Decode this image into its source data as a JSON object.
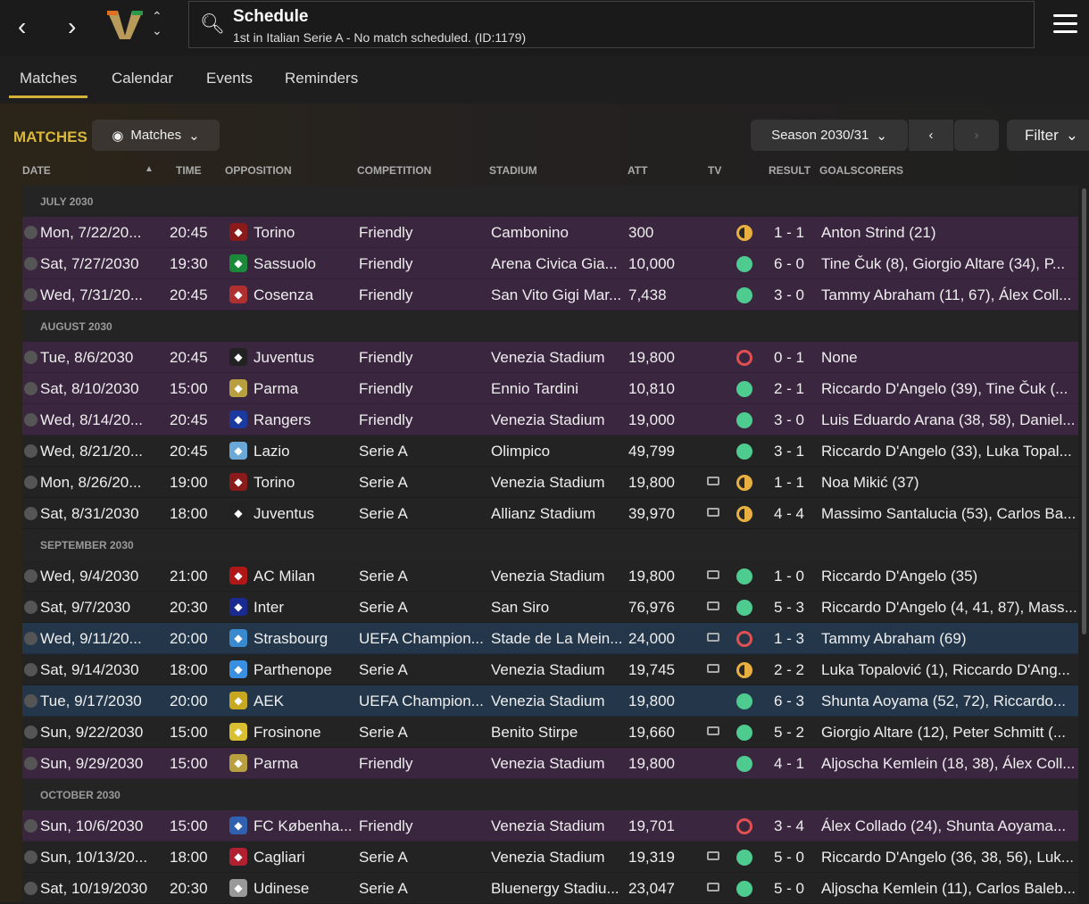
{
  "header": {
    "title": "Schedule",
    "subtitle": "1st in Italian Serie A - No match scheduled. (ID:1179)"
  },
  "tabs": [
    "Matches",
    "Calendar",
    "Events",
    "Reminders"
  ],
  "section": {
    "title": "MATCHES",
    "view_label": "Matches",
    "season": "Season 2030/31",
    "filter": "Filter"
  },
  "columns": [
    "DATE",
    "TIME",
    "OPPOSITION",
    "COMPETITION",
    "STADIUM",
    "ATT",
    "TV",
    "RESULT",
    "GOALSCORERS"
  ],
  "colors": {
    "win": "#4ecb8f",
    "draw": "#e8b040",
    "loss": "#e05050",
    "accent": "#d8b73c"
  },
  "groups": [
    {
      "label": "JULY 2030",
      "rows": [
        {
          "date": "Mon, 7/22/20...",
          "time": "20:45",
          "opp": "Torino",
          "comp": "Friendly",
          "stadium": "Cambonino",
          "att": "300",
          "tv": false,
          "outcome": "draw",
          "result": "1 - 1",
          "scorers": "Anton Strind (21)",
          "style": "p",
          "crest": "#8b1a1a"
        },
        {
          "date": "Sat, 7/27/2030",
          "time": "19:30",
          "opp": "Sassuolo",
          "comp": "Friendly",
          "stadium": "Arena Civica Gia...",
          "att": "10,000",
          "tv": false,
          "outcome": "win",
          "result": "6 - 0",
          "scorers": "Tine Čuk (8), Giorgio Altare (34), P...",
          "style": "p",
          "crest": "#1a8a3a"
        },
        {
          "date": "Wed, 7/31/20...",
          "time": "20:45",
          "opp": "Cosenza",
          "comp": "Friendly",
          "stadium": "San Vito Gigi Mar...",
          "att": "7,438",
          "tv": false,
          "outcome": "win",
          "result": "3 - 0",
          "scorers": "Tammy Abraham (11, 67), Álex Coll...",
          "style": "p",
          "crest": "#b03030"
        }
      ]
    },
    {
      "label": "AUGUST 2030",
      "rows": [
        {
          "date": "Tue, 8/6/2030",
          "time": "20:45",
          "opp": "Juventus",
          "comp": "Friendly",
          "stadium": "Venezia Stadium",
          "att": "19,800",
          "tv": false,
          "outcome": "loss",
          "result": "0 - 1",
          "scorers": "None",
          "style": "p",
          "crest": "#222"
        },
        {
          "date": "Sat, 8/10/2030",
          "time": "15:00",
          "opp": "Parma",
          "comp": "Friendly",
          "stadium": "Ennio Tardini",
          "att": "10,810",
          "tv": false,
          "outcome": "win",
          "result": "2 - 1",
          "scorers": "Riccardo D'Angelo (39), Tine Čuk (...",
          "style": "p",
          "crest": "#b8a040"
        },
        {
          "date": "Wed, 8/14/20...",
          "time": "20:45",
          "opp": "Rangers",
          "comp": "Friendly",
          "stadium": "Venezia Stadium",
          "att": "19,000",
          "tv": false,
          "outcome": "win",
          "result": "3 - 0",
          "scorers": "Luis Eduardo Arana (38, 58), Daniel...",
          "style": "p",
          "crest": "#1a3aa0"
        },
        {
          "date": "Wed, 8/21/20...",
          "time": "20:45",
          "opp": "Lazio",
          "comp": "Serie A",
          "stadium": "Olimpico",
          "att": "49,799",
          "tv": false,
          "outcome": "win",
          "result": "3 - 1",
          "scorers": "Riccardo D'Angelo (33), Luka Topal...",
          "style": "d",
          "crest": "#6aa8d8"
        },
        {
          "date": "Mon, 8/26/20...",
          "time": "19:00",
          "opp": "Torino",
          "comp": "Serie A",
          "stadium": "Venezia Stadium",
          "att": "19,800",
          "tv": true,
          "outcome": "draw",
          "result": "1 - 1",
          "scorers": "Noa Mikić (37)",
          "style": "d",
          "crest": "#8b1a1a"
        },
        {
          "date": "Sat, 8/31/2030",
          "time": "18:00",
          "opp": "Juventus",
          "comp": "Serie A",
          "stadium": "Allianz Stadium",
          "att": "39,970",
          "tv": true,
          "outcome": "draw",
          "result": "4 - 4",
          "scorers": "Massimo Santalucia (53), Carlos Ba...",
          "style": "d",
          "crest": "#222"
        }
      ]
    },
    {
      "label": "SEPTEMBER 2030",
      "rows": [
        {
          "date": "Wed, 9/4/2030",
          "time": "21:00",
          "opp": "AC Milan",
          "comp": "Serie A",
          "stadium": "Venezia Stadium",
          "att": "19,800",
          "tv": true,
          "outcome": "win",
          "result": "1 - 0",
          "scorers": "Riccardo D'Angelo (35)",
          "style": "d",
          "crest": "#b01818"
        },
        {
          "date": "Sat, 9/7/2030",
          "time": "20:30",
          "opp": "Inter",
          "comp": "Serie A",
          "stadium": "San Siro",
          "att": "76,976",
          "tv": true,
          "outcome": "win",
          "result": "5 - 3",
          "scorers": "Riccardo D'Angelo (4, 41, 87), Mass...",
          "style": "d",
          "crest": "#1a2a90"
        },
        {
          "date": "Wed, 9/11/20...",
          "time": "20:00",
          "opp": "Strasbourg",
          "comp": "UEFA Champion...",
          "stadium": "Stade de La Mein...",
          "att": "24,000",
          "tv": true,
          "outcome": "loss",
          "result": "1 - 3",
          "scorers": "Tammy Abraham (69)",
          "style": "b",
          "crest": "#3a8ad0"
        },
        {
          "date": "Sat, 9/14/2030",
          "time": "18:00",
          "opp": "Parthenope",
          "comp": "Serie A",
          "stadium": "Venezia Stadium",
          "att": "19,745",
          "tv": true,
          "outcome": "draw",
          "result": "2 - 2",
          "scorers": "Luka Topalović (1), Riccardo D'Ang...",
          "style": "d",
          "crest": "#3a90e0"
        },
        {
          "date": "Tue, 9/17/2030",
          "time": "20:00",
          "opp": "AEK",
          "comp": "UEFA Champion...",
          "stadium": "Venezia Stadium",
          "att": "19,800",
          "tv": false,
          "outcome": "win",
          "result": "6 - 3",
          "scorers": "Shunta Aoyama (52, 72), Riccardo...",
          "style": "b",
          "crest": "#c8a820"
        },
        {
          "date": "Sun, 9/22/2030",
          "time": "15:00",
          "opp": "Frosinone",
          "comp": "Serie A",
          "stadium": "Benito Stirpe",
          "att": "19,660",
          "tv": true,
          "outcome": "win",
          "result": "5 - 2",
          "scorers": "Giorgio Altare (12), Peter Schmitt (...",
          "style": "d",
          "crest": "#d8c030"
        },
        {
          "date": "Sun, 9/29/2030",
          "time": "15:00",
          "opp": "Parma",
          "comp": "Friendly",
          "stadium": "Venezia Stadium",
          "att": "19,800",
          "tv": false,
          "outcome": "win",
          "result": "4 - 1",
          "scorers": "Aljoscha Kemlein (18, 38), Álex Coll...",
          "style": "p",
          "crest": "#b8a040"
        }
      ]
    },
    {
      "label": "OCTOBER 2030",
      "rows": [
        {
          "date": "Sun, 10/6/2030",
          "time": "15:00",
          "opp": "FC Københa...",
          "comp": "Friendly",
          "stadium": "Venezia Stadium",
          "att": "19,701",
          "tv": false,
          "outcome": "loss",
          "result": "3 - 4",
          "scorers": "Álex Collado (24), Shunta Aoyama...",
          "style": "p",
          "crest": "#3060b0"
        },
        {
          "date": "Sun, 10/13/20...",
          "time": "18:00",
          "opp": "Cagliari",
          "comp": "Serie A",
          "stadium": "Venezia Stadium",
          "att": "19,319",
          "tv": true,
          "outcome": "win",
          "result": "5 - 0",
          "scorers": "Riccardo D'Angelo (36, 38, 56), Luk...",
          "style": "d",
          "crest": "#b02030"
        },
        {
          "date": "Sat, 10/19/2030",
          "time": "20:30",
          "opp": "Udinese",
          "comp": "Serie A",
          "stadium": "Bluenergy Stadiu...",
          "att": "23,047",
          "tv": true,
          "outcome": "win",
          "result": "5 - 0",
          "scorers": "Aljoscha Kemlein (11), Carlos Baleb...",
          "style": "d",
          "crest": "#999"
        }
      ]
    }
  ]
}
